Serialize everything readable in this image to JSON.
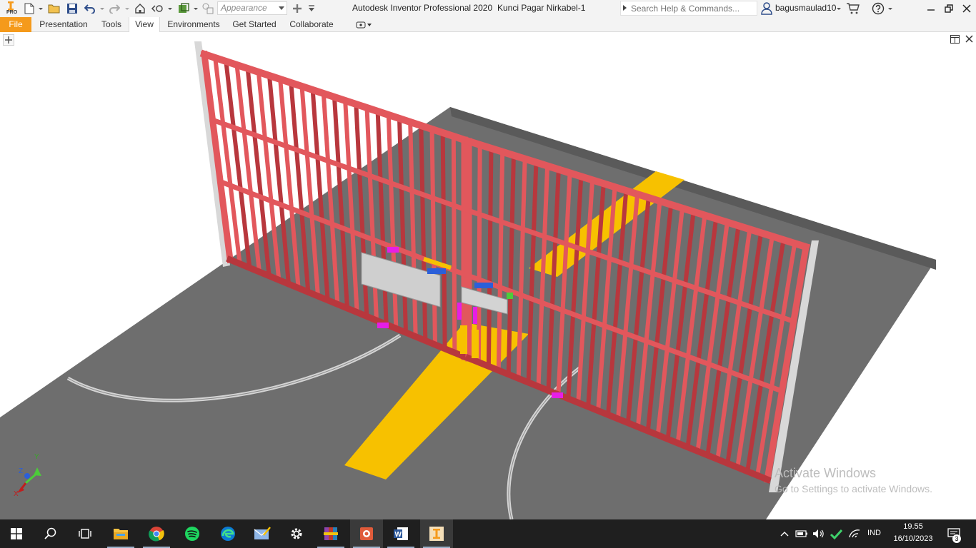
{
  "window": {
    "app_title": "Autodesk Inventor Professional 2020",
    "document_name": "Kunci Pagar Nirkabel-1",
    "appearance_placeholder": "Appearance",
    "search_placeholder": "Search Help & Commands...",
    "user_name": "bagusmaulad10",
    "logo_text": "PRO"
  },
  "ribbon": {
    "tabs": [
      {
        "label": "File"
      },
      {
        "label": "Presentation"
      },
      {
        "label": "Tools"
      },
      {
        "label": "View",
        "active": true
      },
      {
        "label": "Environments"
      },
      {
        "label": "Get Started"
      },
      {
        "label": "Collaborate"
      }
    ]
  },
  "viewport": {
    "watermark_line1": "Activate Windows",
    "watermark_line2": "Go to Settings to activate Windows.",
    "triad_labels": {
      "x": "X",
      "y": "Y",
      "z": "Z"
    }
  },
  "taskbar": {
    "apps": [
      "start-icon",
      "search-icon",
      "task-view-icon",
      "file-explorer-icon",
      "chrome-icon",
      "spotify-icon",
      "edge-icon",
      "mail-icon",
      "settings-icon",
      "winrar-icon",
      "image-viewer-icon",
      "word-icon",
      "inventor-icon"
    ],
    "language": "IND",
    "time": "19.55",
    "date": "16/10/2023",
    "notification_count": "3"
  },
  "colors": {
    "inventor_orange": "#f59a1b",
    "gate_red": "#e2575c",
    "road": "#6e6e6e",
    "road_marking": "#f7c100",
    "taskbar": "#1f1f1f"
  }
}
